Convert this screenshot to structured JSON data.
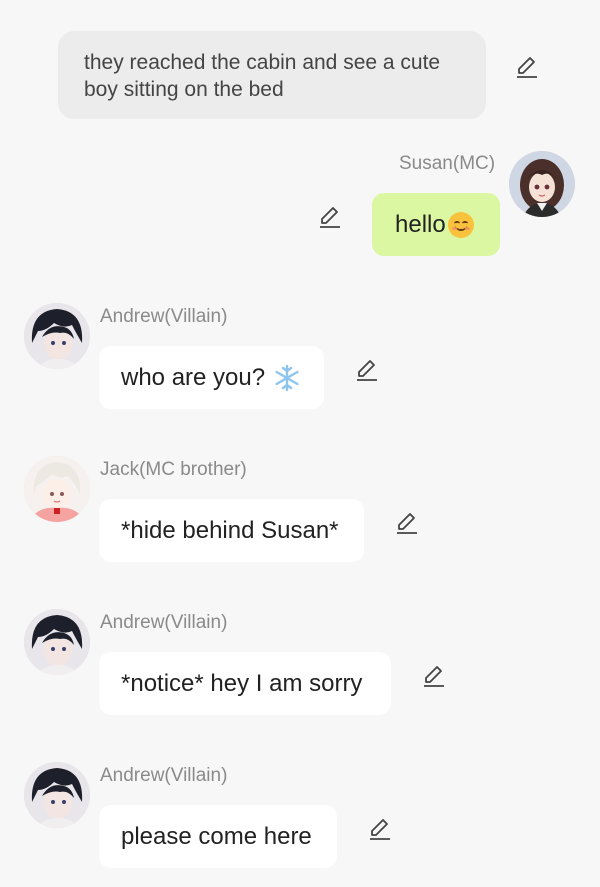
{
  "narration": {
    "text": "they reached the cabin and see a cute boy sitting on the bed"
  },
  "messages": [
    {
      "speaker": "Susan(MC)",
      "text": "hello",
      "emoji": "smiling-face-emoji",
      "side": "right"
    },
    {
      "speaker": "Andrew(Villain)",
      "text": "who are you?",
      "emoji": "snowflake-emoji",
      "side": "left"
    },
    {
      "speaker": "Jack(MC brother)",
      "text": "*hide behind Susan*",
      "side": "left"
    },
    {
      "speaker": "Andrew(Villain)",
      "text": "*notice* hey I am sorry",
      "side": "left"
    },
    {
      "speaker": "Andrew(Villain)",
      "text": "please come here",
      "side": "left"
    }
  ],
  "icons": {
    "edit": "pencil-edit-icon"
  },
  "colors": {
    "background": "#f7f7f7",
    "narration_bubble": "#ececec",
    "my_bubble": "#dcf7a2",
    "other_bubble": "#ffffff",
    "speaker_name": "#8a8a8a"
  }
}
